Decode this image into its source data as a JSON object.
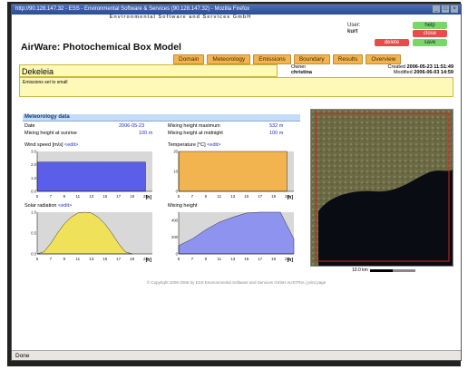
{
  "browser": {
    "title": "http://90.128.147.32 - ESS - Environmental Software & Services (90.128.147.32) - Mozilla Firefox",
    "status": "Done"
  },
  "header": {
    "company": "Environmental Software and Services GmbH",
    "app_title": "AirWare: Photochemical Box Model",
    "user_label": "User:",
    "user_name": "kurt"
  },
  "controls": {
    "help": "help",
    "close": "close",
    "delete": "delete",
    "save": "save"
  },
  "tabs": [
    "Domain",
    "Meteorology",
    "Emissions",
    "Boundary",
    "Results",
    "Overview"
  ],
  "project": {
    "name": "Dekeleia",
    "owner_label": "Owner",
    "owner": "christina",
    "created_label": "Created",
    "created": "2006-05-23 11:51:49",
    "modified_label": "Modified",
    "modified": "2006-06-03 14:59",
    "description": "Emissions set to small"
  },
  "meteorology": {
    "title": "Meteorology data",
    "date_label": "Date",
    "date": "2006-05-23",
    "mix_max_label": "Mixing height maximum",
    "mix_max": "532 m",
    "mix_sunrise_label": "Mixing height at sunrise",
    "mix_sunrise": "100 m",
    "mix_midnight_label": "Mixing height at midnight",
    "mix_midnight": "100 m"
  },
  "charts": {
    "wind": {
      "label": "Wind speed [m/s]",
      "edit": "<edit>"
    },
    "temp": {
      "label": "Temperature [°C]",
      "edit": "<edit>"
    },
    "solar": {
      "label": "Solar radiation",
      "edit": "<edit>"
    },
    "mixing": {
      "label": "Mixing height"
    }
  },
  "chart_data": [
    {
      "type": "area",
      "title": "Wind speed [m/s]",
      "x": [
        5,
        7,
        9,
        11,
        13,
        15,
        17,
        19,
        21
      ],
      "y": [
        2.2,
        2.2,
        2.2,
        2.2,
        2.2,
        2.2,
        2.2,
        2.2,
        2.2
      ],
      "xlabel": "[h]",
      "ylim": [
        0,
        3.0
      ],
      "yticks": [
        "0.0",
        "1.0",
        "2.0",
        "3.0"
      ],
      "color": "#5b5ee8"
    },
    {
      "type": "area",
      "title": "Temperature [°C]",
      "x": [
        5,
        7,
        9,
        11,
        13,
        15,
        17,
        19,
        21
      ],
      "y": [
        22,
        22,
        22,
        22,
        22,
        22,
        22,
        22,
        22
      ],
      "xlabel": "[h]",
      "ylim": [
        0,
        20
      ],
      "yticks": [
        "0",
        "10",
        "20"
      ],
      "color": "#f2b44f"
    },
    {
      "type": "area",
      "title": "Solar radiation",
      "x": [
        5,
        6,
        7,
        8,
        9,
        10,
        11,
        12,
        13,
        14,
        15,
        16,
        17,
        18,
        19
      ],
      "y": [
        0,
        0.05,
        0.25,
        0.5,
        0.72,
        0.88,
        0.98,
        1.0,
        0.98,
        0.88,
        0.72,
        0.5,
        0.25,
        0.05,
        0
      ],
      "xlabel": "[h]",
      "ylim": [
        0,
        1.0
      ],
      "yticks": [
        "0.0",
        "0.5",
        "1.0"
      ],
      "color": "#efe25a"
    },
    {
      "type": "area",
      "title": "Mixing height",
      "x": [
        5,
        7,
        9,
        11,
        13,
        15,
        17,
        19,
        20,
        21,
        22
      ],
      "y": [
        100,
        180,
        290,
        380,
        440,
        490,
        520,
        532,
        500,
        340,
        180
      ],
      "xlabel": "[h]",
      "ylim": [
        0,
        500
      ],
      "yticks": [
        "0",
        "200",
        "400"
      ],
      "color": "#8e93ef"
    }
  ],
  "map": {
    "scale": "10.0 km"
  },
  "footer": "© Copyright 2005-2006 by ESS Environmental Software and Services GmbH AUSTRIA | print page"
}
